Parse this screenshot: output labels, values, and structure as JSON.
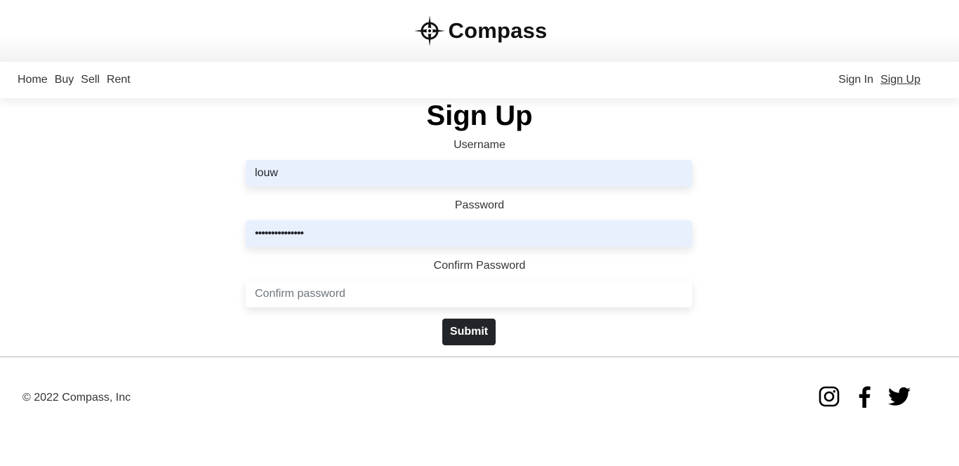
{
  "brand": {
    "name": "Compass",
    "logo_icon": "compass-rose-icon"
  },
  "nav": {
    "left": [
      {
        "label": "Home"
      },
      {
        "label": "Buy"
      },
      {
        "label": "Sell"
      },
      {
        "label": "Rent"
      }
    ],
    "right": [
      {
        "label": "Sign In"
      },
      {
        "label": "Sign Up",
        "active": true
      }
    ]
  },
  "form": {
    "title": "Sign Up",
    "username": {
      "label": "Username",
      "value": "louw"
    },
    "password": {
      "label": "Password",
      "value": "•••••••••••••••"
    },
    "confirm": {
      "label": "Confirm Password",
      "value": "",
      "placeholder": "Confirm password"
    },
    "submit_label": "Submit"
  },
  "footer": {
    "copyright": "© 2022 Compass, Inc",
    "social_icons": [
      "instagram-icon",
      "facebook-icon",
      "twitter-icon"
    ]
  },
  "colors": {
    "autofill_bg": "#e8f0fe",
    "button_bg": "#212529",
    "button_text": "#ffffff"
  }
}
